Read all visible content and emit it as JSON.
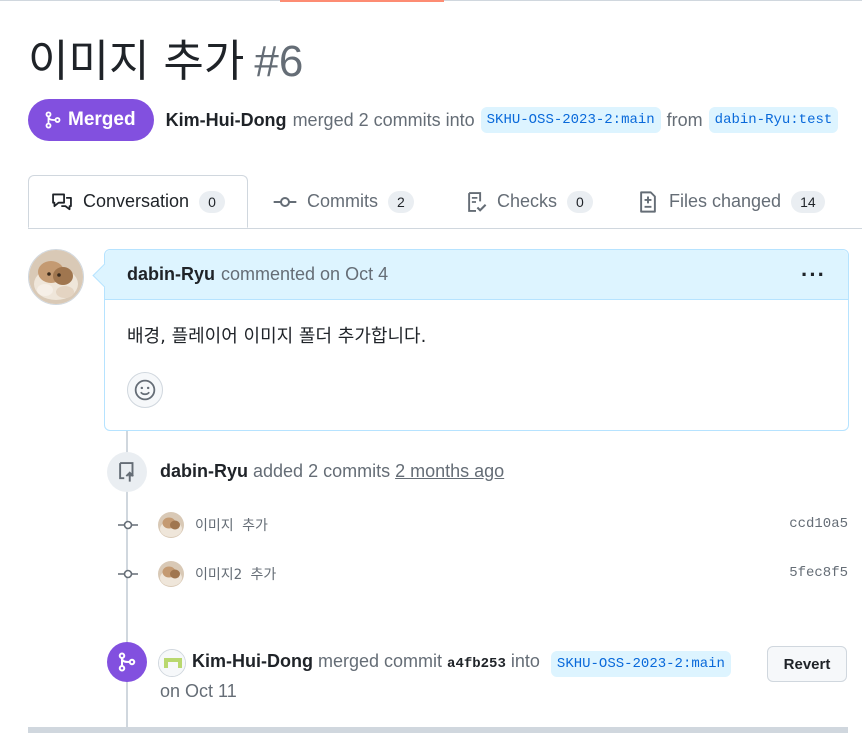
{
  "pr": {
    "title": "이미지 추가",
    "number": "#6",
    "state": "Merged",
    "author": "Kim-Hui-Dong",
    "summary_pre": "merged 2 commits into",
    "base_branch": "SKHU-OSS-2023-2:main",
    "from_word": "from",
    "head_branch": "dabin-Ryu:test"
  },
  "tabs": [
    {
      "label": "Conversation",
      "count": "0",
      "icon": "comment-discussion-icon"
    },
    {
      "label": "Commits",
      "count": "2",
      "icon": "git-commit-icon"
    },
    {
      "label": "Checks",
      "count": "0",
      "icon": "checklist-icon"
    },
    {
      "label": "Files changed",
      "count": "14",
      "icon": "file-diff-icon"
    }
  ],
  "comment": {
    "author": "dabin-Ryu",
    "action": "commented on Oct 4",
    "body": "배경, 플레이어 이미지 폴더 추가합니다."
  },
  "commits_event": {
    "author": "dabin-Ryu",
    "action": "added 2 commits",
    "time": "2 months ago",
    "commits": [
      {
        "message": "이미지 추가",
        "sha": "ccd10a5"
      },
      {
        "message": "이미지2 추가",
        "sha": "5fec8f5"
      }
    ]
  },
  "merge_event": {
    "author": "Kim-Hui-Dong",
    "action": "merged commit",
    "sha": "a4fb253",
    "into": "into",
    "branch": "SKHU-OSS-2023-2:main",
    "date": "on Oct 11",
    "revert_label": "Revert"
  },
  "colors": {
    "merged": "#8250df",
    "branch_bg": "#ddf4ff",
    "link": "#0969da"
  }
}
